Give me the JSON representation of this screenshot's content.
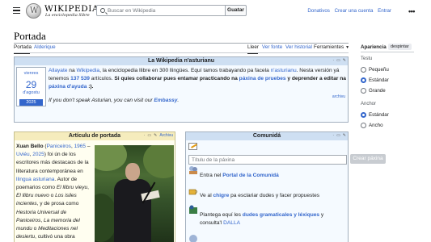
{
  "header": {
    "wordmark": "WIKIPEDIA",
    "tagline": "La enciclopedia llibre",
    "search_placeholder": "Buscar en Wikipedia",
    "search_button": "Guatar",
    "links": [
      "Donativos",
      "Crear una cuenta",
      "Entrar"
    ]
  },
  "page": {
    "title": "Portada",
    "tabs_left": [
      "Portada",
      "Alderique"
    ],
    "tabs_right": [
      "Lleer",
      "Ver fonte",
      "Ver historial",
      "Ferramientes"
    ]
  },
  "sidebar": {
    "heading": "Apariencia",
    "hide": "despintar",
    "text_group": "Testu",
    "text_options": [
      "Pequeñu",
      "Estándar",
      "Grande"
    ],
    "text_selected": "Estándar",
    "width_group": "Anchor",
    "width_options": [
      "Estándar",
      "Ancho"
    ],
    "width_selected": "Estándar"
  },
  "welcome": {
    "title": "La Wikipedia n'asturianu",
    "date": {
      "weekday": "vienres",
      "day": "29",
      "month": "d'agostu",
      "year": "2025"
    },
    "line1_a": "Allayate",
    "line1_b": " na ",
    "line1_c": "Wikipedia",
    "line1_d": ", la enciclopedia llibre en 300 llingües. Equí tamos trabayando pa facela ",
    "line1_e": "n'asturianu",
    "line1_f": ". Nesta versión yá tenemos ",
    "count": "137 539",
    "line2_a": " artículos. ",
    "line2_b": "Si quies collaborar pues entamar practicando na ",
    "line2_c": "páxina de pruebes",
    "line2_d": " y deprender a editar na ",
    "line2_e": "páxina d'ayuda",
    "line2_f": " :).",
    "english_a": "If you don't speak Asturian, you can visit our ",
    "english_b": "Embassy",
    "english_c": ".",
    "archive": "archivu"
  },
  "featured": {
    "title": "Artículu de portada",
    "archive": "Archivu",
    "subject": "Xuan Bello",
    "link1": "Paniceiros",
    "year1": "1965",
    "place2": "Uviéu",
    "year2": "2025",
    "t1": ") foi ún de los escritores más destacaos de la lliteratura contemporánea en ",
    "lang": "llingua asturiana",
    "t2": ". Autor de poemarios como ",
    "book1": "El llibru vieyu",
    "book2": "El llibru nuevo",
    "book3": "Los isiles incientes",
    "t3": ", y de prosa como ",
    "book4": "Hestoria Universal de Paniceiros",
    "book5": "La memoria del mundu",
    "book6": "Meditaciones nel desiertu",
    "t4": ", cultivó una obra"
  },
  "community": {
    "title": "Comunidá",
    "input_placeholder": "Títulu de la páxina",
    "create_button": "Crear páxina",
    "item1_a": "Entra nel ",
    "item1_b": "Portal de la Comunidá",
    "item2_a": "Ve al ",
    "item2_b": "chigre",
    "item2_c": " pa esclariar dudes y facer propuestes",
    "item3_a": "Plantega equí les ",
    "item3_b": "dudes gramaticales y léxiques",
    "item3_c": " y consulta'l ",
    "item3_d": "DALLA"
  }
}
